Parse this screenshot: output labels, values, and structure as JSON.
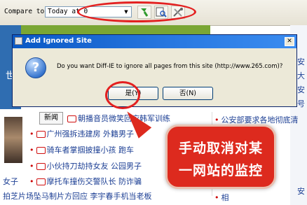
{
  "toolbar": {
    "compare_label": "Compare to",
    "compare_value": "Today at 0",
    "buttons": [
      "refresh-icon",
      "zoom-page-icon",
      "settings-icon"
    ]
  },
  "background": {
    "top_left_char": "世",
    "news_button": "新闻",
    "rows": [
      "朝播音员微笑回应韩军训练",
      "广州强拆违建房 外籍男子",
      "骑车者掌掴披撞小孩 跑车",
      "小伙持刀劫持女友 公园男子",
      "摩托车撞伤交警队长 防诈骗",
      "拍芝片场坠马制片方回应 李宇春手机当老板"
    ],
    "left_word": "女子",
    "right_rows": [
      "公安部要求各地彻底清",
      "相"
    ],
    "right_col_chars": [
      "安",
      "大",
      "安",
      "号",
      "安"
    ]
  },
  "dialog": {
    "title": "Add Ignored Site",
    "message": "Do you want Diff-IE to ignore all pages from this site (http://www.265.com)?",
    "yes_label": "是(Y)",
    "no_label": "否(N)"
  },
  "callout": {
    "line1": "手动取消对某",
    "line2": "一网站的监控"
  },
  "colors": {
    "annotation_red": "#e32020",
    "callout_bg": "#dd2a1e",
    "title_bar": "#0a58c4"
  }
}
